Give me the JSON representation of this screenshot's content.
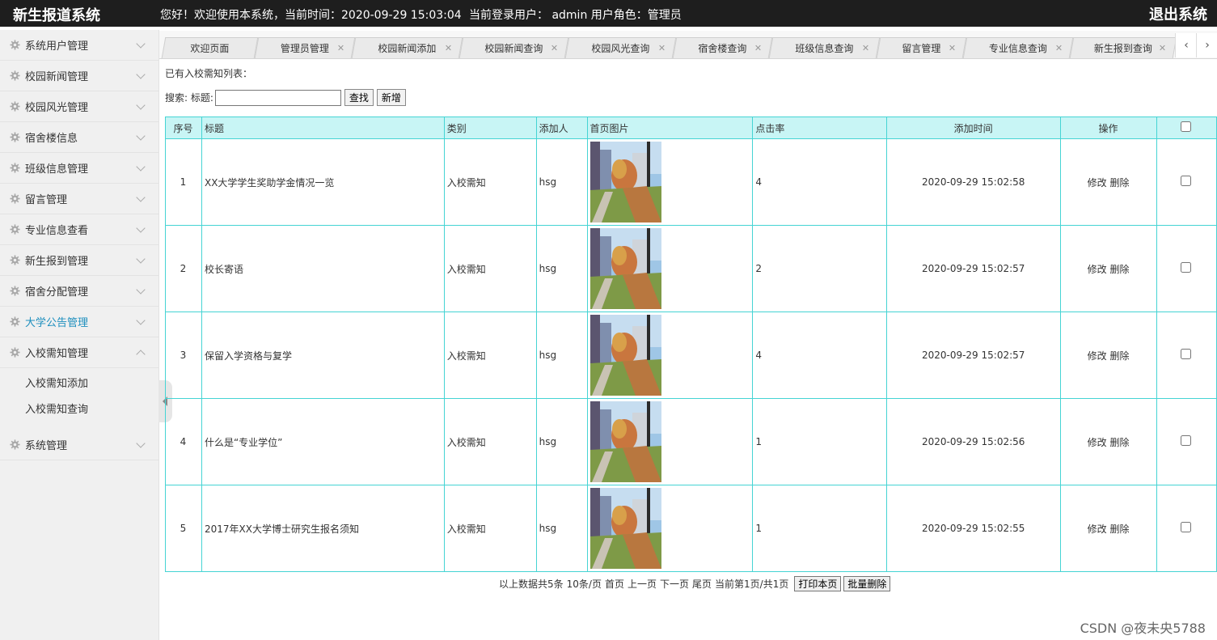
{
  "header": {
    "title": "新生报道系统",
    "welcome": "您好！欢迎使用本系统，当前时间：2020-09-29 15:03:04",
    "user_info": "当前登录用户： admin  用户角色：管理员",
    "logout": "退出系统",
    "bg_color": "#1e1e1e"
  },
  "sidebar": {
    "items": [
      {
        "label": "系统用户管理",
        "icon": "gear-icon"
      },
      {
        "label": "校园新闻管理",
        "icon": "gear-icon"
      },
      {
        "label": "校园风光管理",
        "icon": "gear-icon"
      },
      {
        "label": "宿舍楼信息",
        "icon": "gear-icon"
      },
      {
        "label": "班级信息管理",
        "icon": "gear-icon"
      },
      {
        "label": "留言管理",
        "icon": "gear-icon"
      },
      {
        "label": "专业信息查看",
        "icon": "gear-icon"
      },
      {
        "label": "新生报到管理",
        "icon": "gear-icon"
      },
      {
        "label": "宿舍分配管理",
        "icon": "gear-icon"
      },
      {
        "label": "大学公告管理",
        "icon": "gear-icon",
        "active": true
      },
      {
        "label": "入校需知管理",
        "icon": "gear-icon",
        "expanded": true
      },
      {
        "label": "系统管理",
        "icon": "gear-icon"
      }
    ],
    "submenu": [
      "入校需知添加",
      "入校需知查询"
    ],
    "active_color": "#1e8fbe"
  },
  "tabs": [
    {
      "label": "欢迎页面"
    },
    {
      "label": "管理员管理"
    },
    {
      "label": "校园新闻添加"
    },
    {
      "label": "校园新闻查询"
    },
    {
      "label": "校园风光查询"
    },
    {
      "label": "宿舍楼查询"
    },
    {
      "label": "班级信息查询"
    },
    {
      "label": "留言管理"
    },
    {
      "label": "专业信息查询"
    },
    {
      "label": "新生报到查询"
    }
  ],
  "content": {
    "list_title": "已有入校需知列表：",
    "search_label": "搜索: 标题:",
    "search_value": "",
    "search_button": "查找",
    "add_button": "新增"
  },
  "table": {
    "headers": [
      "序号",
      "标题",
      "类别",
      "添加人",
      "首页图片",
      "点击率",
      "添加时间",
      "操作"
    ],
    "rows": [
      {
        "no": "1",
        "title": "XX大学学生奖助学金情况一览",
        "category": "入校需知",
        "adder": "hsg",
        "clicks": "4",
        "time": "2020-09-29 15:02:58"
      },
      {
        "no": "2",
        "title": "校长寄语",
        "category": "入校需知",
        "adder": "hsg",
        "clicks": "2",
        "time": "2020-09-29 15:02:57"
      },
      {
        "no": "3",
        "title": "保留入学资格与复学",
        "category": "入校需知",
        "adder": "hsg",
        "clicks": "4",
        "time": "2020-09-29 15:02:57"
      },
      {
        "no": "4",
        "title": "什么是“专业学位”",
        "category": "入校需知",
        "adder": "hsg",
        "clicks": "1",
        "time": "2020-09-29 15:02:56"
      },
      {
        "no": "5",
        "title": "2017年XX大学博士研究生报名须知",
        "category": "入校需知",
        "adder": "hsg",
        "clicks": "1",
        "time": "2020-09-29 15:02:55"
      }
    ],
    "edit_label": "修改",
    "delete_label": "删除",
    "border_color": "#45d4d4",
    "header_bg": "#c8f5f5"
  },
  "pager": {
    "summary": "以上数据共5条",
    "per_page": "10条/页",
    "first": "首页",
    "prev": "上一页",
    "next": "下一页",
    "last": "尾页",
    "current": "当前第1页/共1页",
    "print_button": "打印本页",
    "batch_delete_button": "批量删除"
  },
  "watermark": "CSDN @夜未央5788"
}
